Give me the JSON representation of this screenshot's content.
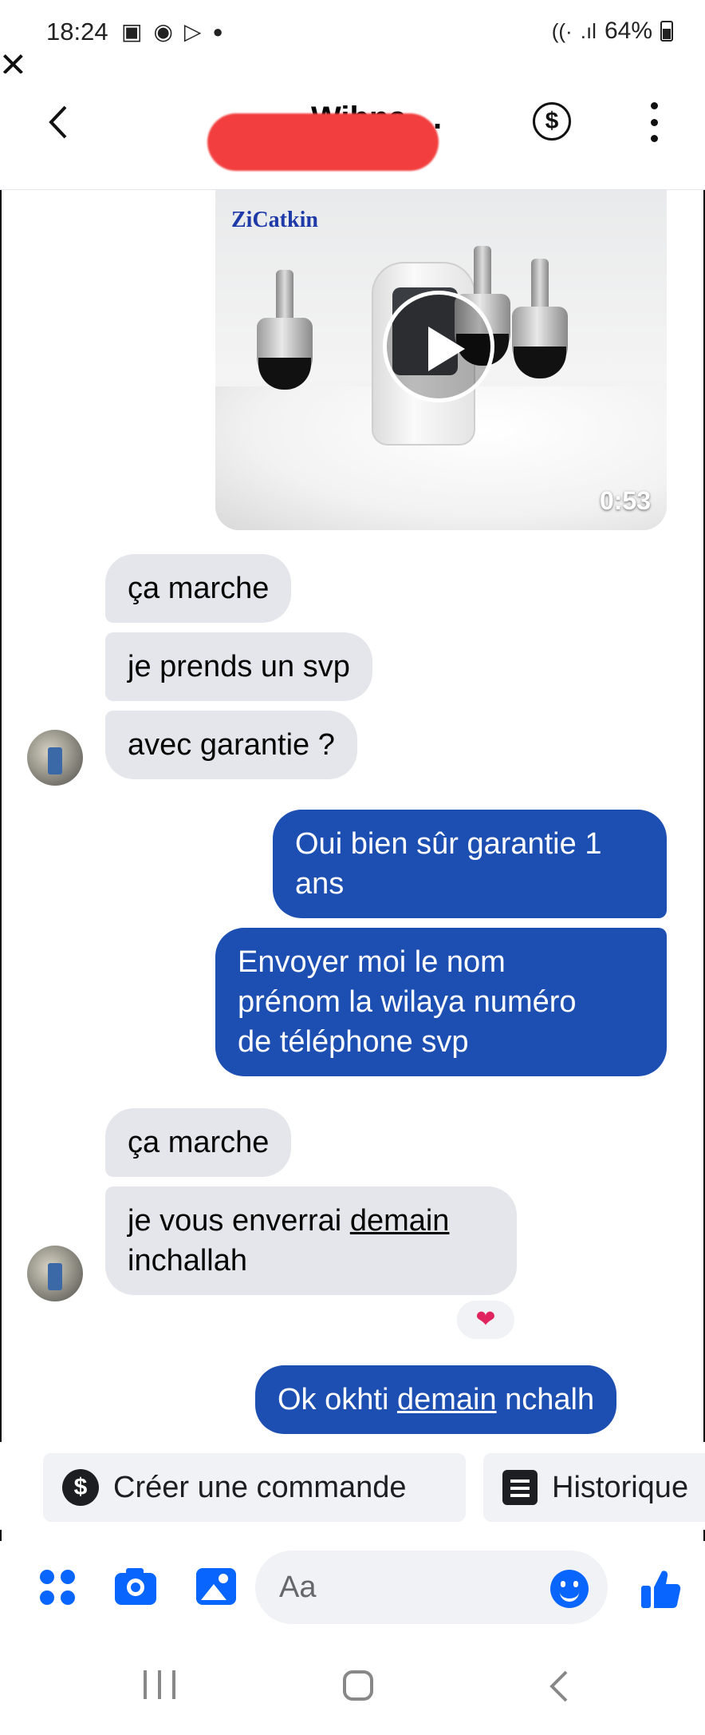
{
  "status_bar": {
    "time": "18:24",
    "left_icons": [
      "gallery-icon",
      "messenger-icon",
      "play-store-icon",
      "dot"
    ],
    "battery": "64%"
  },
  "header": {
    "contact_name": "Wibna ...",
    "contact_name_redacted": true,
    "actions": [
      "back-icon",
      "dollar-icon",
      "more-icon"
    ]
  },
  "video": {
    "brand": "ZiCatkin",
    "duration": "0:53"
  },
  "messages": [
    {
      "side": "in",
      "text": "ça marche"
    },
    {
      "side": "in",
      "text": "je prends un svp"
    },
    {
      "side": "in",
      "text": "avec garantie ?"
    },
    {
      "side": "out",
      "line1": "Oui bien sûr garantie 1",
      "line2": "ans"
    },
    {
      "side": "out",
      "line1": "Envoyer moi le nom",
      "line2": "prénom la wilaya numéro",
      "line3": "de téléphone svp"
    },
    {
      "side": "in",
      "text": "ça marche"
    },
    {
      "side": "in",
      "line1_pre": "je vous enverrai ",
      "line1_link": "demain",
      "line2": "inchallah",
      "reaction": "❤"
    },
    {
      "side": "out",
      "pre": "Ok okhti ",
      "link": "demain",
      "post": " nchalh"
    }
  ],
  "chips": {
    "create_order": "Créer une commande",
    "history": "Historique"
  },
  "composer": {
    "placeholder": "Aa"
  },
  "colors": {
    "outgoing_bubble": "#1d4fb3",
    "incoming_bubble": "#e4e6eb",
    "accent": "#0866ff",
    "redaction": "#f23e3e"
  }
}
